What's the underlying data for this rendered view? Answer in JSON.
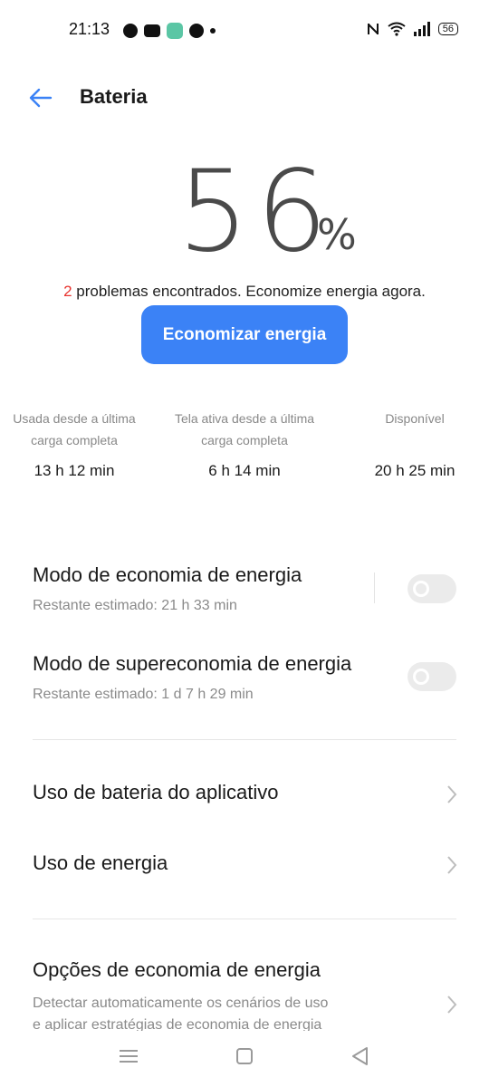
{
  "status": {
    "time": "21:13",
    "battery_level": "56"
  },
  "header": {
    "title": "Bateria"
  },
  "battery": {
    "percent_value": "56",
    "percent_sign": "%",
    "problems_count": "2",
    "problems_text": " problemas encontrados. Economize energia agora.",
    "save_button": "Economizar energia"
  },
  "stats": [
    {
      "label_line1": "Usada desde a última",
      "label_line2": "carga completa",
      "value": "13 h 12 min"
    },
    {
      "label_line1": "Tela ativa desde a última",
      "label_line2": "carga completa",
      "value": "6 h 14 min"
    },
    {
      "label_line1": "Disponível",
      "label_line2": "",
      "value": "20 h 25 min"
    }
  ],
  "modes": [
    {
      "title": "Modo de economia de energia",
      "subtitle": "Restante estimado:  21 h 33 min",
      "enabled": false
    },
    {
      "title": "Modo de supereconomia de energia",
      "subtitle": "Restante estimado:  1 d 7 h 29 min",
      "enabled": false
    }
  ],
  "menu": [
    {
      "title": "Uso de bateria do aplicativo"
    },
    {
      "title": "Uso de energia"
    }
  ],
  "options": {
    "title": "Opções de economia de energia",
    "desc_line1": "Detectar automaticamente os cenários de uso",
    "desc_line2": "e aplicar estratégias de economia de energia"
  },
  "colors": {
    "accent": "#3b82f6",
    "problem_count": "#e8332e",
    "toggle_off": "#ebebeb"
  },
  "icons": {
    "back": "arrow-left-icon",
    "chevron": "chevron-right-icon",
    "nav_menu": "menu-icon",
    "nav_home": "square-home-icon",
    "nav_back": "triangle-back-icon"
  }
}
